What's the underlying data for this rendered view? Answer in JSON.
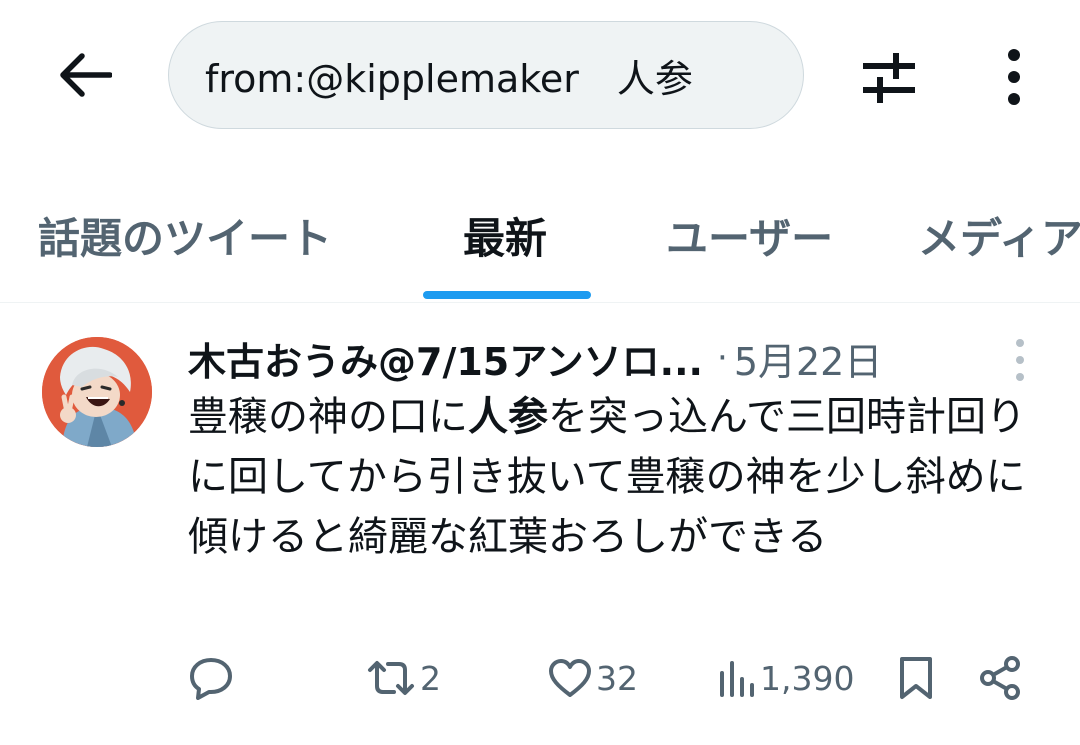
{
  "header": {
    "search_query": "from:@kipplemaker　人参"
  },
  "tabs": [
    {
      "label": "話題のツイート"
    },
    {
      "label": "最新"
    },
    {
      "label": "ユーザー"
    },
    {
      "label": "メディア"
    }
  ],
  "tweet": {
    "author": "木古おうみ@7/15アンソロ...",
    "separator": "·",
    "time": "5月22日",
    "text_before": "豊穣の神の口に",
    "text_highlight": "人参",
    "text_after": "を突っ込んで三回時計回りに回してから引き抜いて豊穣の神を少し斜めに傾けると綺麗な紅葉おろしができる",
    "retweets": "2",
    "likes": "32",
    "views": "1,390"
  },
  "colors": {
    "accent": "#1d9bf0",
    "muted": "#536471",
    "text": "#0f1419",
    "search_bg": "#eff3f4"
  }
}
